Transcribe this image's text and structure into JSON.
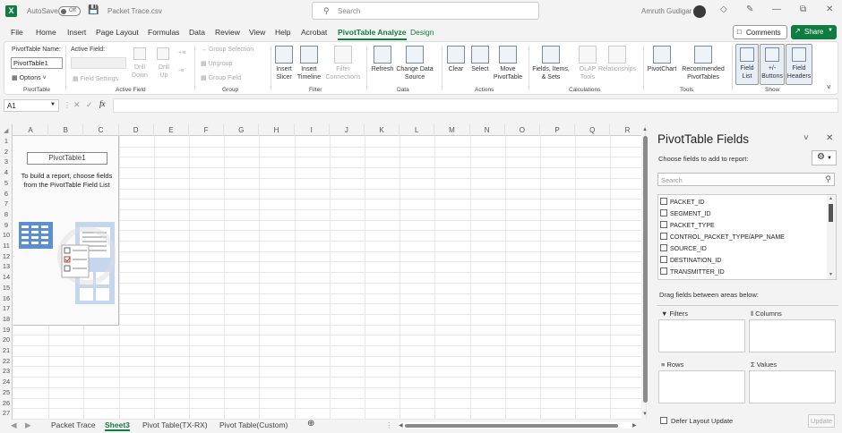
{
  "titlebar": {
    "app_icon": "X",
    "autosave_label": "AutoSave",
    "autosave_state": "Off",
    "filename": "Packet Trace.csv",
    "search_placeholder": "Search",
    "user_name": "Amruth Gudigar"
  },
  "menu": {
    "tabs": [
      "File",
      "Home",
      "Insert",
      "Page Layout",
      "Formulas",
      "Data",
      "Review",
      "View",
      "Help",
      "Acrobat",
      "PivotTable Analyze",
      "Design"
    ],
    "comments_label": "Comments",
    "share_label": "Share"
  },
  "ribbon": {
    "pivottable": {
      "name_label": "PivotTable Name:",
      "name_value": "PivotTable1",
      "options_label": "Options",
      "group_label": "PivotTable"
    },
    "active_field": {
      "label": "Active Field:",
      "settings_label": "Field Settings",
      "drill_down": "Drill Down",
      "drill_up": "Drill Up",
      "group_label": "Active Field"
    },
    "group": {
      "selection": "Group Selection",
      "ungroup": "Ungroup",
      "field": "Group Field",
      "group_label": "Group"
    },
    "filter": {
      "slicer": "Insert Slicer",
      "timeline": "Insert Timeline",
      "connections": "Filter Connections",
      "group_label": "Filter"
    },
    "data": {
      "refresh": "Refresh",
      "change_source": "Change Data Source",
      "group_label": "Data"
    },
    "actions": {
      "clear": "Clear",
      "select": "Select",
      "move": "Move PivotTable",
      "group_label": "Actions"
    },
    "calculations": {
      "fields": "Fields, Items, & Sets",
      "olap": "OLAP Tools",
      "relationships": "Relationships",
      "group_label": "Calculations"
    },
    "tools": {
      "pivotchart": "PivotChart",
      "recommended": "Recommended PivotTables",
      "group_label": "Tools"
    },
    "show": {
      "field_list": "Field List",
      "buttons": "+/- Buttons",
      "headers": "Field Headers",
      "group_label": "Show"
    }
  },
  "formula_bar": {
    "name_box": "A1",
    "fx": "fx",
    "value": ""
  },
  "sheet": {
    "columns": [
      "A",
      "B",
      "C",
      "D",
      "E",
      "F",
      "G",
      "H",
      "I",
      "J",
      "K",
      "L",
      "M",
      "N",
      "O",
      "P",
      "Q",
      "R"
    ],
    "rows": [
      "1",
      "2",
      "3",
      "4",
      "5",
      "6",
      "7",
      "8",
      "9",
      "10",
      "11",
      "12",
      "13",
      "14",
      "15",
      "16",
      "17",
      "18",
      "19",
      "20",
      "21",
      "22",
      "23",
      "24",
      "25",
      "26",
      "27"
    ],
    "pivot_name": "PivotTable1",
    "pivot_message": "To build a report, choose fields from the PivotTable Field List"
  },
  "sheet_tabs": {
    "tabs": [
      "Packet Trace",
      "Sheet3",
      "Pivot Table(TX-RX)",
      "Pivot Table(Custom)"
    ],
    "active_index": 1
  },
  "pane": {
    "title": "PivotTable Fields",
    "subtitle": "Choose fields to add to report:",
    "search_placeholder": "Search",
    "fields": [
      "PACKET_ID",
      "SEGMENT_ID",
      "PACKET_TYPE",
      "CONTROL_PACKET_TYPE/APP_NAME",
      "SOURCE_ID",
      "DESTINATION_ID",
      "TRANSMITTER_ID"
    ],
    "drag_label": "Drag fields between areas below:",
    "areas": {
      "filters": "Filters",
      "columns": "Columns",
      "rows": "Rows",
      "values": "Values"
    },
    "defer_label": "Defer Layout Update",
    "update_label": "Update"
  },
  "colors": {
    "accent": "#107c41"
  }
}
